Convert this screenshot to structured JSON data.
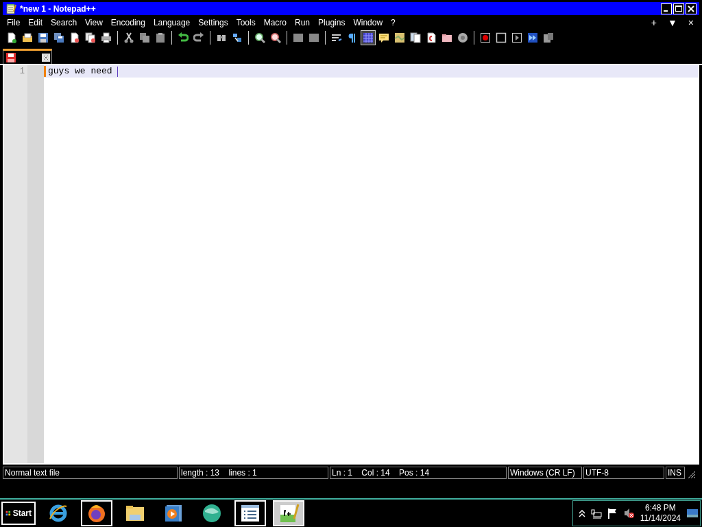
{
  "window": {
    "title": "*new 1 - Notepad++"
  },
  "menu": [
    {
      "label": "File"
    },
    {
      "label": "Edit"
    },
    {
      "label": "Search"
    },
    {
      "label": "View"
    },
    {
      "label": "Encoding"
    },
    {
      "label": "Language"
    },
    {
      "label": "Settings"
    },
    {
      "label": "Tools"
    },
    {
      "label": "Macro"
    },
    {
      "label": "Run"
    },
    {
      "label": "Plugins"
    },
    {
      "label": "Window"
    },
    {
      "label": "?"
    }
  ],
  "menu_right": [
    "+",
    "▼",
    "×"
  ],
  "toolbar": [
    {
      "pressed": false
    },
    {
      "pressed": false
    },
    {
      "pressed": false
    },
    {
      "pressed": false
    },
    {
      "pressed": false
    },
    {
      "pressed": false
    },
    {
      "pressed": false
    },
    {
      "pressed": false
    },
    {
      "pressed": false
    },
    {
      "pressed": false
    },
    {
      "pressed": false
    },
    {
      "pressed": false
    },
    {
      "pressed": false
    },
    {
      "pressed": false
    },
    {
      "pressed": false
    },
    {
      "pressed": false
    },
    {
      "pressed": false
    },
    {
      "pressed": false
    },
    {
      "pressed": false
    },
    {
      "pressed": false
    },
    {
      "pressed": true
    },
    {
      "pressed": false
    },
    {
      "pressed": false
    },
    {
      "pressed": false
    },
    {
      "pressed": false
    },
    {
      "pressed": false
    },
    {
      "pressed": false
    },
    {
      "pressed": false
    },
    {
      "pressed": false
    },
    {
      "pressed": false
    },
    {
      "pressed": false
    },
    {
      "pressed": false
    }
  ],
  "tabs": [
    {
      "selected": true,
      "modified": true
    }
  ],
  "editor": {
    "lines": [
      {
        "number": "1",
        "text": "guys we need ",
        "current": true
      }
    ]
  },
  "status_bar": [
    "Normal text file",
    "length : 13    lines : 1",
    "Ln : 1    Col : 14    Pos : 14",
    "Windows (CR LF)",
    "UTF-8",
    "INS"
  ],
  "taskbar": {
    "start": "Start",
    "apps": [
      {
        "open": false,
        "selected": false
      },
      {
        "open": true,
        "selected": false
      },
      {
        "open": false,
        "selected": false
      },
      {
        "open": false,
        "selected": false
      },
      {
        "open": false,
        "selected": false
      },
      {
        "open": true,
        "selected": false
      },
      {
        "open": true,
        "selected": true
      }
    ],
    "time": "6:48 PM",
    "date": "11/14/2024"
  }
}
